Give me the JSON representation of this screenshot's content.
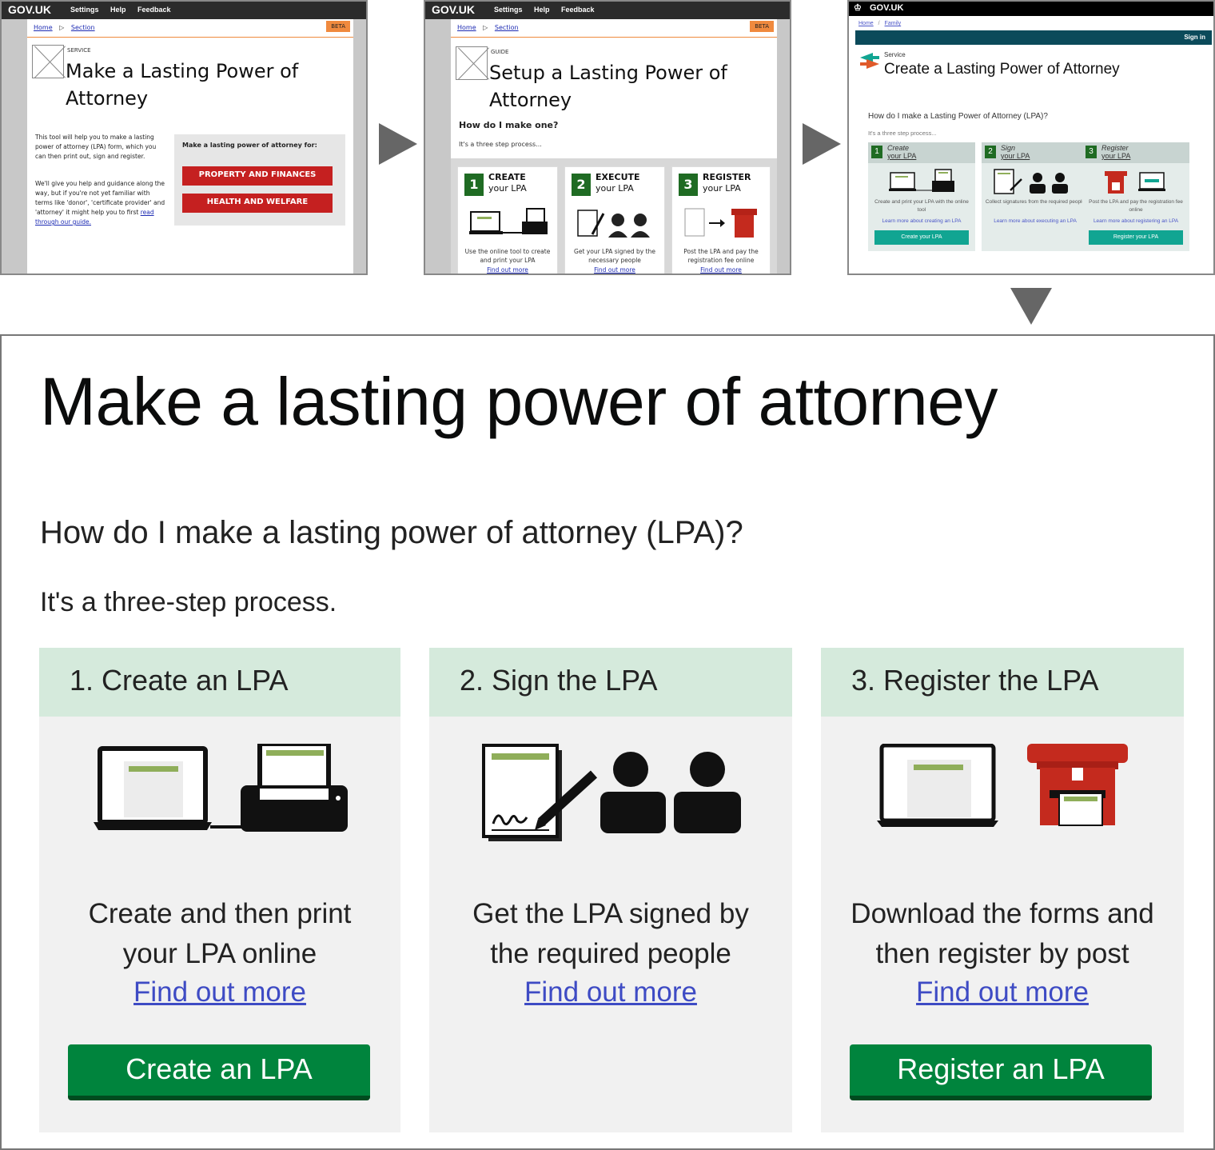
{
  "frame1": {
    "logo": "GOV.UK",
    "nav": [
      "Settings",
      "Help",
      "Feedback"
    ],
    "crumbs": [
      "Home",
      "Section"
    ],
    "badge": "BETA",
    "kicker": "SERVICE",
    "title": "Make a Lasting Power of Attorney",
    "para1": "This tool will help you to make a lasting power of attorney (LPA) form, which you can then print out, sign and register.",
    "para2_a": "We'll give you help and guidance along the way, but if you're not yet familiar with terms like 'donor', 'certificate provider' and 'attorney' it might help you to first ",
    "para2_link": "read through our guide.",
    "panel_heading": "Make a lasting power of attorney for:",
    "buttons": [
      "PROPERTY AND FINANCES",
      "HEALTH AND WELFARE"
    ]
  },
  "frame2": {
    "logo": "GOV.UK",
    "nav": [
      "Settings",
      "Help",
      "Feedback"
    ],
    "crumbs": [
      "Home",
      "Section"
    ],
    "badge": "BETA",
    "kicker": "GUIDE",
    "title": "Setup a Lasting Power of Attorney",
    "question": "How do I make one?",
    "sub": "It's a three step process...",
    "steps": [
      {
        "num": "1",
        "verb": "CREATE",
        "noun": "your LPA",
        "desc": "Use the online tool to create and print your LPA",
        "link": "Find out more"
      },
      {
        "num": "2",
        "verb": "EXECUTE",
        "noun": "your LPA",
        "desc": "Get your LPA signed by the necessary people",
        "link": "Find out more"
      },
      {
        "num": "3",
        "verb": "REGISTER",
        "noun": "your LPA",
        "desc": "Post the LPA and pay the registration fee online",
        "link": "Find out more"
      }
    ]
  },
  "frame3": {
    "logo": "GOV.UK",
    "crumbs": [
      "Home",
      "Family"
    ],
    "signin": "Sign in",
    "kicker": "Service",
    "title": "Create a Lasting Power of Attorney",
    "question": "How do I make a Lasting Power of Attorney (LPA)?",
    "sub": "It's a three step process...",
    "steps": [
      {
        "num": "1",
        "verb": "Create",
        "noun": "your LPA",
        "desc": "Create and print your LPA with the online tool",
        "link": "Learn more about creating an LPA",
        "button": "Create your LPA"
      },
      {
        "num": "2",
        "verb": "Sign",
        "noun": "your LPA",
        "desc": "Collect signatures from the required people",
        "link": "Learn more about executing an LPA",
        "button": ""
      },
      {
        "num": "3",
        "verb": "Register",
        "noun": "your LPA",
        "desc": "Post the LPA and pay the registration fee online",
        "link": "Learn more about registering an LPA",
        "button": "Register your LPA"
      }
    ]
  },
  "final": {
    "title": "Make a lasting power of attorney",
    "question": "How do I make a lasting power of attorney (LPA)?",
    "sub": "It's a three-step process.",
    "steps": [
      {
        "heading": "1. Create an LPA",
        "desc_line1": "Create and then print",
        "desc_line2": "your LPA online",
        "link": "Find out more",
        "button": "Create an LPA",
        "icon": "laptop-and-printer-icon"
      },
      {
        "heading": "2. Sign the LPA",
        "desc_line1": "Get the LPA signed by",
        "desc_line2": "the required people",
        "link": "Find out more",
        "button": "",
        "icon": "signature-and-people-icon"
      },
      {
        "heading": "3. Register the LPA",
        "desc_line1": "Download the forms and",
        "desc_line2": "then register by post",
        "link": "Find out more",
        "button": "Register an LPA",
        "icon": "laptop-and-postbox-icon"
      }
    ]
  },
  "colors": {
    "green_button": "#00843d",
    "card_header": "#d5eadc",
    "card_bg": "#f1f1f1",
    "link": "#3e4bc4",
    "sketch_red": "#c52020",
    "beta_orange": "#f08a3e",
    "teal_button": "#11a592"
  }
}
